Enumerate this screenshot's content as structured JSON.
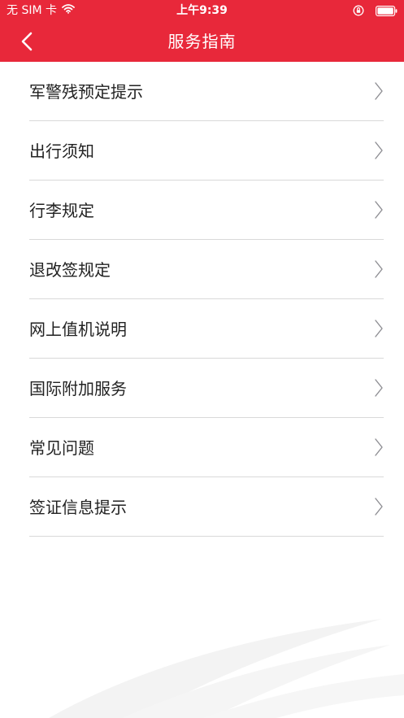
{
  "status_bar": {
    "carrier": "无 SIM 卡",
    "time": "上午9:39",
    "wifi_icon": "wifi-icon",
    "lock_icon": "orientation-lock-icon",
    "battery_icon": "battery-icon"
  },
  "nav": {
    "title": "服务指南",
    "back_icon": "chevron-left-icon"
  },
  "colors": {
    "brand": "#e8283a",
    "divider": "#d9d9d9",
    "text": "#222222",
    "chevron": "#8e8e93"
  },
  "menu": {
    "items": [
      {
        "label": "军警残预定提示"
      },
      {
        "label": "出行须知"
      },
      {
        "label": "行李规定"
      },
      {
        "label": "退改签规定"
      },
      {
        "label": "网上值机说明"
      },
      {
        "label": "国际附加服务"
      },
      {
        "label": "常见问题"
      },
      {
        "label": "签证信息提示"
      }
    ]
  }
}
